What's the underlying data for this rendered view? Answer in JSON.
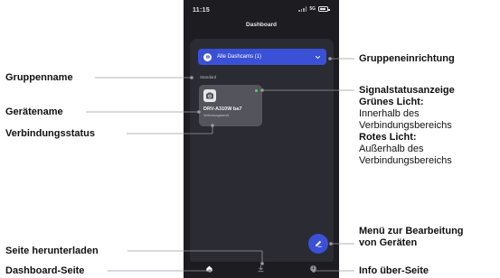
{
  "phone": {
    "status_bar": {
      "time": "11:15",
      "network": "5G"
    },
    "title": "Dashboard",
    "group_dropdown": {
      "label": "Alle Dashcams (1)"
    },
    "group_name": "Standard",
    "device": {
      "name": "DRV-A310W ba7",
      "connection_status": "Verbindungsbereit",
      "status_color": "#4cd964"
    },
    "accent_color": "#3a50d6",
    "nav": {
      "items": [
        "home-icon",
        "download-icon",
        "info-icon"
      ]
    }
  },
  "annotations": {
    "group_setup": "Gruppeneinrichtung",
    "group_name": "Gruppenname",
    "device_name": "Gerätename",
    "connection_status": "Verbindungsstatus",
    "signal_status": {
      "title": "Signalstatusanzeige",
      "green_title": "Grünes Licht:",
      "green_line1": "Innerhalb des",
      "green_line2": "Verbindungsbereichs",
      "red_title": "Rotes Licht:",
      "red_line1": "Außerhalb des",
      "red_line2": "Verbindungsbereichs"
    },
    "edit_menu": {
      "line1": "Menü zur Bearbeitung",
      "line2": "von Geräten"
    },
    "download_page": "Seite herunterladen",
    "dashboard_page": "Dashboard-Seite",
    "info_page": "Info über-Seite"
  }
}
